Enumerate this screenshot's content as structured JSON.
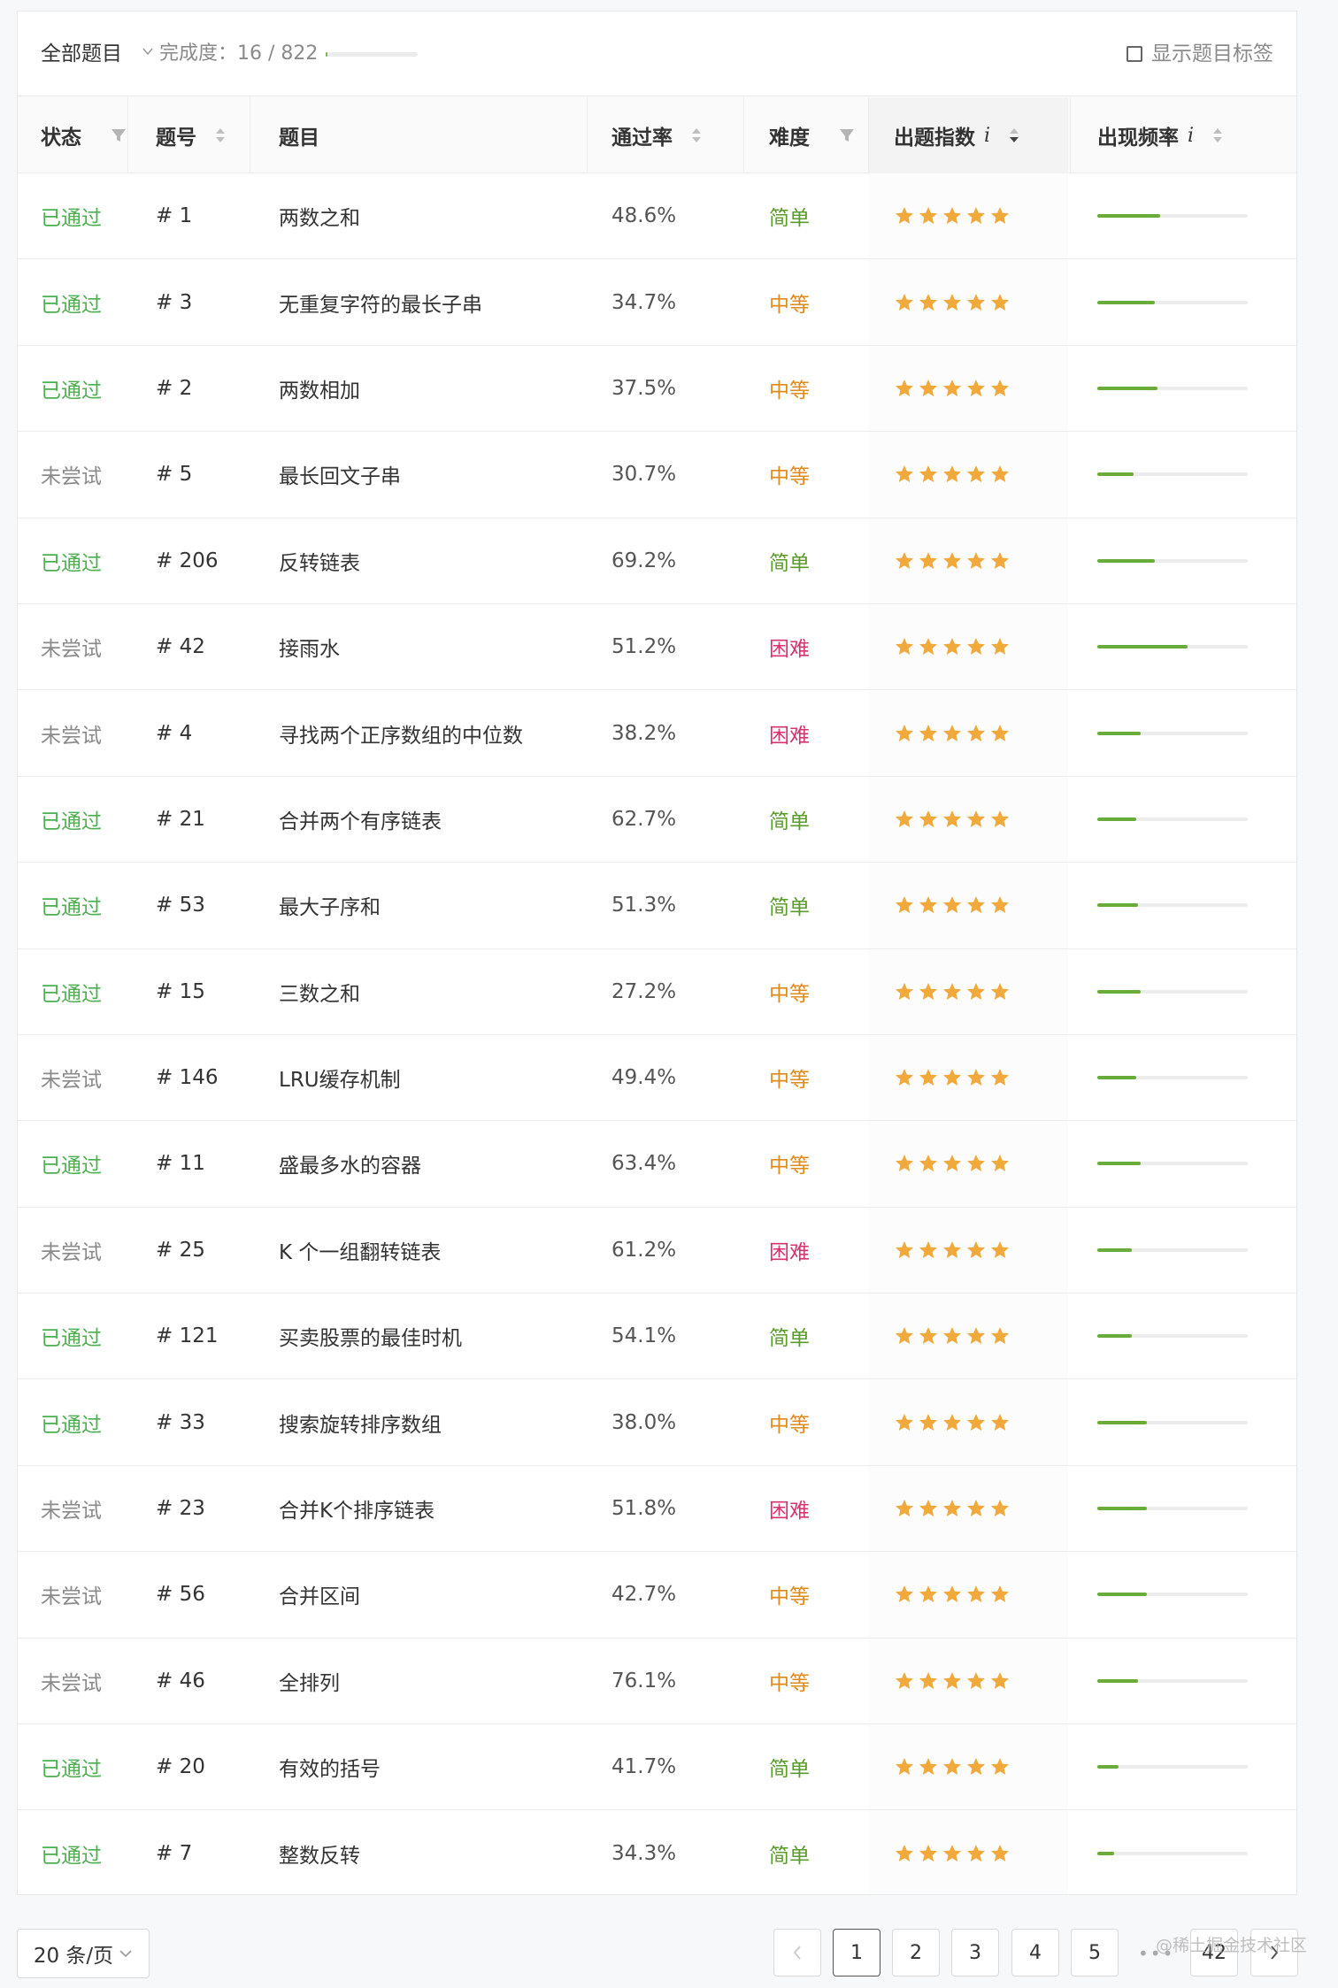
{
  "toolbar": {
    "all_label": "全部题目",
    "progress_label": "完成度：16 / 822",
    "progress_fraction": 0.0195,
    "show_tags_label": "显示题目标签"
  },
  "columns": {
    "status": "状态",
    "number": "题号",
    "title": "题目",
    "pass_rate": "通过率",
    "difficulty": "难度",
    "index": "出题指数",
    "frequency": "出现频率",
    "info": "i"
  },
  "colors": {
    "passed": "#4caf50",
    "easy": "#5a9c2c",
    "medium": "#e08a1e",
    "hard": "#d6336c",
    "star": "#f0a93a",
    "freq_bar": "#6aac3a"
  },
  "rows": [
    {
      "status": "已通过",
      "kind": "pass",
      "num": "# 1",
      "title": "两数之和",
      "rate": "48.6%",
      "diff": "简单",
      "dk": "easy",
      "stars": 5,
      "freq": 0.42
    },
    {
      "status": "已通过",
      "kind": "pass",
      "num": "# 3",
      "title": "无重复字符的最长子串",
      "rate": "34.7%",
      "diff": "中等",
      "dk": "mid",
      "stars": 5,
      "freq": 0.38
    },
    {
      "status": "已通过",
      "kind": "pass",
      "num": "# 2",
      "title": "两数相加",
      "rate": "37.5%",
      "diff": "中等",
      "dk": "mid",
      "stars": 5,
      "freq": 0.4
    },
    {
      "status": "未尝试",
      "kind": "none",
      "num": "# 5",
      "title": "最长回文子串",
      "rate": "30.7%",
      "diff": "中等",
      "dk": "mid",
      "stars": 5,
      "freq": 0.24
    },
    {
      "status": "已通过",
      "kind": "pass",
      "num": "# 206",
      "title": "反转链表",
      "rate": "69.2%",
      "diff": "简单",
      "dk": "easy",
      "stars": 5,
      "freq": 0.38
    },
    {
      "status": "未尝试",
      "kind": "none",
      "num": "# 42",
      "title": "接雨水",
      "rate": "51.2%",
      "diff": "困难",
      "dk": "hard",
      "stars": 5,
      "freq": 0.6
    },
    {
      "status": "未尝试",
      "kind": "none",
      "num": "# 4",
      "title": "寻找两个正序数组的中位数",
      "rate": "38.2%",
      "diff": "困难",
      "dk": "hard",
      "stars": 5,
      "freq": 0.29
    },
    {
      "status": "已通过",
      "kind": "pass",
      "num": "# 21",
      "title": "合并两个有序链表",
      "rate": "62.7%",
      "diff": "简单",
      "dk": "easy",
      "stars": 5,
      "freq": 0.26
    },
    {
      "status": "已通过",
      "kind": "pass",
      "num": "# 53",
      "title": "最大子序和",
      "rate": "51.3%",
      "diff": "简单",
      "dk": "easy",
      "stars": 5,
      "freq": 0.27
    },
    {
      "status": "已通过",
      "kind": "pass",
      "num": "# 15",
      "title": "三数之和",
      "rate": "27.2%",
      "diff": "中等",
      "dk": "mid",
      "stars": 5,
      "freq": 0.29
    },
    {
      "status": "未尝试",
      "kind": "none",
      "num": "# 146",
      "title": "LRU缓存机制",
      "rate": "49.4%",
      "diff": "中等",
      "dk": "mid",
      "stars": 5,
      "freq": 0.26
    },
    {
      "status": "已通过",
      "kind": "pass",
      "num": "# 11",
      "title": "盛最多水的容器",
      "rate": "63.4%",
      "diff": "中等",
      "dk": "mid",
      "stars": 5,
      "freq": 0.29
    },
    {
      "status": "未尝试",
      "kind": "none",
      "num": "# 25",
      "title": "K 个一组翻转链表",
      "rate": "61.2%",
      "diff": "困难",
      "dk": "hard",
      "stars": 5,
      "freq": 0.23
    },
    {
      "status": "已通过",
      "kind": "pass",
      "num": "# 121",
      "title": "买卖股票的最佳时机",
      "rate": "54.1%",
      "diff": "简单",
      "dk": "easy",
      "stars": 5,
      "freq": 0.23
    },
    {
      "status": "已通过",
      "kind": "pass",
      "num": "# 33",
      "title": "搜索旋转排序数组",
      "rate": "38.0%",
      "diff": "中等",
      "dk": "mid",
      "stars": 5,
      "freq": 0.33
    },
    {
      "status": "未尝试",
      "kind": "none",
      "num": "# 23",
      "title": "合并K个排序链表",
      "rate": "51.8%",
      "diff": "困难",
      "dk": "hard",
      "stars": 5,
      "freq": 0.33
    },
    {
      "status": "未尝试",
      "kind": "none",
      "num": "# 56",
      "title": "合并区间",
      "rate": "42.7%",
      "diff": "中等",
      "dk": "mid",
      "stars": 5,
      "freq": 0.33
    },
    {
      "status": "未尝试",
      "kind": "none",
      "num": "# 46",
      "title": "全排列",
      "rate": "76.1%",
      "diff": "中等",
      "dk": "mid",
      "stars": 5,
      "freq": 0.27
    },
    {
      "status": "已通过",
      "kind": "pass",
      "num": "# 20",
      "title": "有效的括号",
      "rate": "41.7%",
      "diff": "简单",
      "dk": "easy",
      "stars": 5,
      "freq": 0.14
    },
    {
      "status": "已通过",
      "kind": "pass",
      "num": "# 7",
      "title": "整数反转",
      "rate": "34.3%",
      "diff": "简单",
      "dk": "easy",
      "stars": 5,
      "freq": 0.11
    }
  ],
  "pagination": {
    "page_size": "20 条/页",
    "pages": [
      "1",
      "2",
      "3",
      "4",
      "5"
    ],
    "current": "1",
    "last": "42",
    "watermark": "@稀土掘金技术社区"
  }
}
